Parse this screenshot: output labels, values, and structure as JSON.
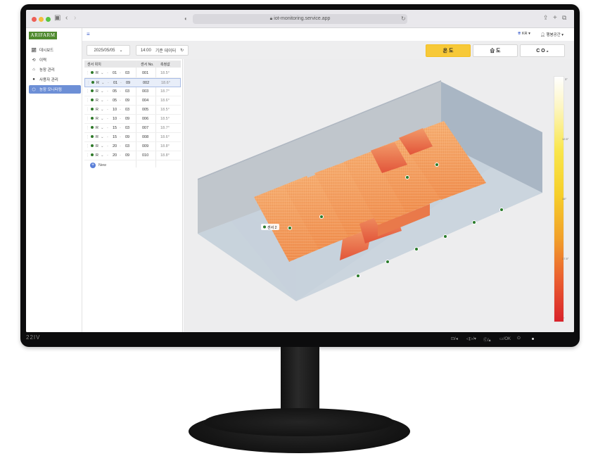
{
  "monitor": {
    "model": "22IV",
    "osd_buttons": [
      "⊡/◂",
      "◁▷/▾",
      "Ⓒ/▴",
      "▭/OK",
      "⏻"
    ]
  },
  "browser": {
    "url": "iot-monitoring.service.app"
  },
  "app": {
    "logo": "ARIFARM",
    "nav": [
      {
        "label": "대시보드",
        "icon": "chart-icon"
      },
      {
        "label": "이력",
        "icon": "history-icon"
      },
      {
        "label": "농장 관리",
        "icon": "farm-icon"
      },
      {
        "label": "사용자 관리",
        "icon": "user-icon"
      },
      {
        "label": "농장 모니터링",
        "icon": "cube-icon",
        "active": true
      }
    ],
    "topbar": {
      "language": "KR",
      "user": "행봉공간"
    },
    "toolbar": {
      "date": "2025/05/05",
      "time": "14:00",
      "time_suffix": "기준 데이터"
    },
    "metrics": [
      {
        "label": "온 도",
        "active": true
      },
      {
        "label": "습 도",
        "active": false
      },
      {
        "label": "C O ₂",
        "active": false
      }
    ],
    "sensor_table": {
      "headers": {
        "position": "센서 위치",
        "number": "센서 No.",
        "value": "측정값"
      },
      "rows": [
        {
          "r": "R",
          "a": "01",
          "b": "03",
          "no": "001",
          "val": "18.5°"
        },
        {
          "r": "R",
          "a": "01",
          "b": "09",
          "no": "002",
          "val": "18.6°",
          "selected": true
        },
        {
          "r": "R",
          "a": "05",
          "b": "03",
          "no": "003",
          "val": "18.7°"
        },
        {
          "r": "R",
          "a": "05",
          "b": "09",
          "no": "004",
          "val": "18.6°"
        },
        {
          "r": "R",
          "a": "10",
          "b": "03",
          "no": "005",
          "val": "18.5°"
        },
        {
          "r": "R",
          "a": "10",
          "b": "09",
          "no": "006",
          "val": "18.5°"
        },
        {
          "r": "R",
          "a": "15",
          "b": "03",
          "no": "007",
          "val": "18.7°"
        },
        {
          "r": "R",
          "a": "15",
          "b": "09",
          "no": "008",
          "val": "18.6°"
        },
        {
          "r": "R",
          "a": "20",
          "b": "03",
          "no": "009",
          "val": "18.8°"
        },
        {
          "r": "R",
          "a": "20",
          "b": "09",
          "no": "010",
          "val": "18.8°"
        }
      ],
      "new_label": "New"
    },
    "scene": {
      "sensor_tag": "센서 2"
    },
    "legend": {
      "labels": [
        "3°",
        "12.5°",
        "15°",
        "17.5°",
        "°"
      ]
    }
  }
}
